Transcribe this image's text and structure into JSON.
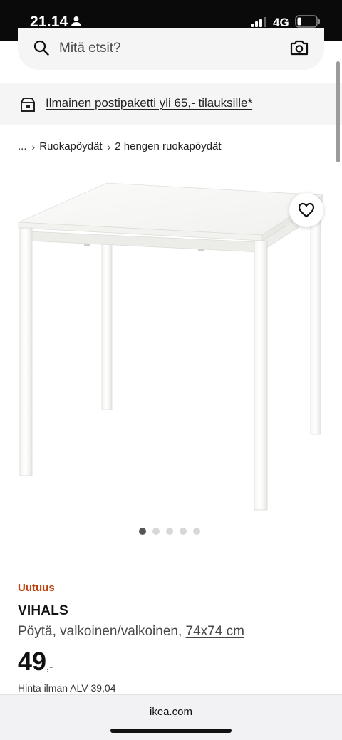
{
  "status_bar": {
    "time": "21.14",
    "network": "4G",
    "icons": [
      "person-icon",
      "signal-icon",
      "battery-icon"
    ]
  },
  "search": {
    "placeholder": "Mitä etsit?",
    "icons": [
      "search-icon",
      "camera-icon"
    ]
  },
  "delivery_banner": {
    "text": "Ilmainen postipaketti yli 65,- tilauksille*",
    "icon": "delivery-box-icon"
  },
  "breadcrumb": {
    "ellipsis": "...",
    "items": [
      "Ruokapöydät",
      "2 hengen ruokapöydät"
    ]
  },
  "gallery": {
    "image": "white-table-image",
    "dot_count": 5,
    "active_index": 0,
    "wishlist_icon": "heart-icon"
  },
  "product": {
    "badge": "Uutuus",
    "name": "VIHALS",
    "description": "Pöytä, valkoinen/valkoinen,",
    "size": "74x74 cm",
    "price_main": "49",
    "price_suffix": ",-",
    "vat_text": "Hinta ilman ALV 39,04"
  },
  "browser": {
    "url": "ikea.com"
  },
  "colors": {
    "badge": "#c2410c",
    "panel_bg": "#f5f5f5"
  }
}
